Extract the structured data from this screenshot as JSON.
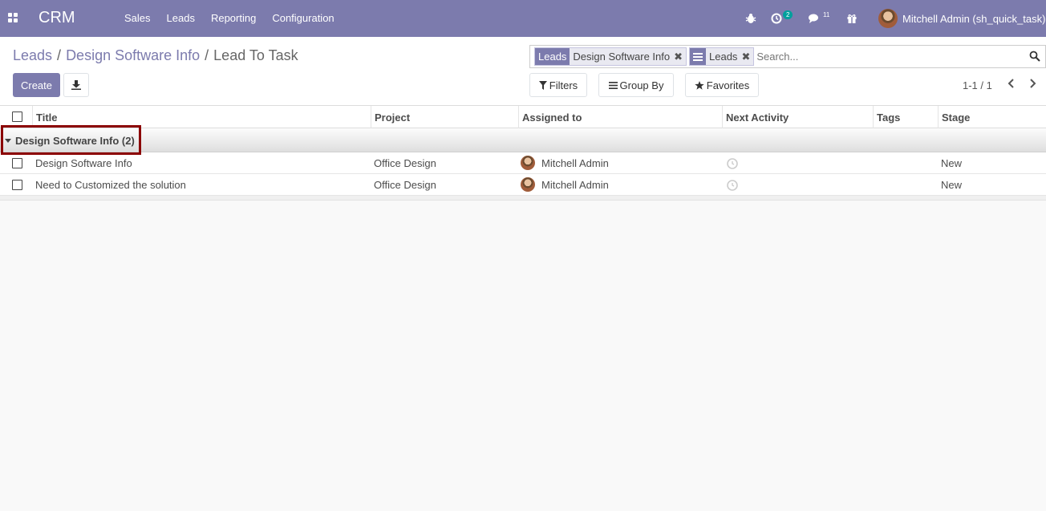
{
  "navbar": {
    "brand": "CRM",
    "menu": [
      "Sales",
      "Leads",
      "Reporting",
      "Configuration"
    ],
    "activity_count": "2",
    "message_count": "11",
    "user_name": "Mitchell Admin (sh_quick_task)"
  },
  "breadcrumb": {
    "items": [
      "Leads",
      "Design Software Info"
    ],
    "current": "Lead To Task"
  },
  "buttons": {
    "create": "Create",
    "filters": "Filters",
    "group_by": "Group By",
    "favorites": "Favorites"
  },
  "search": {
    "facets": [
      {
        "label": "Leads",
        "value": "Design Software Info"
      },
      {
        "label": "",
        "value": "Leads"
      }
    ],
    "placeholder": "Search..."
  },
  "pager": "1-1 / 1",
  "table": {
    "columns": [
      "Title",
      "Project",
      "Assigned to",
      "Next Activity",
      "Tags",
      "Stage"
    ],
    "group": "Design Software Info (2)",
    "rows": [
      {
        "title": "Design Software Info",
        "project": "Office Design",
        "assigned": "Mitchell Admin",
        "tags": "",
        "stage": "New"
      },
      {
        "title": "Need to Customized the solution",
        "project": "Office Design",
        "assigned": "Mitchell Admin",
        "tags": "",
        "stage": "New"
      }
    ]
  },
  "colors": {
    "brand": "#7c7bad",
    "badge": "#00a09d",
    "highlight": "#8b0000"
  }
}
